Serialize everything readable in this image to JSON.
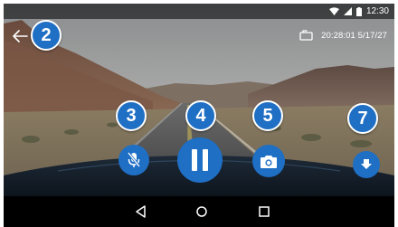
{
  "status_bar": {
    "time": "12:30",
    "icons": [
      "wifi-icon",
      "signal-icon",
      "battery-icon"
    ]
  },
  "top_bar": {
    "back_icon": "back-arrow-icon",
    "rotate_icon": "rotate-screen-icon",
    "timestamp": "20:28:01 5/17/27"
  },
  "callouts": {
    "c2": "2",
    "c3": "3",
    "c4": "4",
    "c5": "5",
    "c7": "7"
  },
  "controls": {
    "mic": {
      "icon": "mic-off-icon"
    },
    "pause": {
      "icon": "pause-icon"
    },
    "snapshot": {
      "icon": "camera-icon"
    },
    "download": {
      "icon": "download-icon"
    }
  },
  "nav_bar": {
    "icons": [
      "nav-back-icon",
      "nav-home-icon",
      "nav-recents-icon"
    ]
  },
  "colors": {
    "accent": "#1f6fc4",
    "callout_border": "#ffffff",
    "nav_bar": "#000000"
  }
}
